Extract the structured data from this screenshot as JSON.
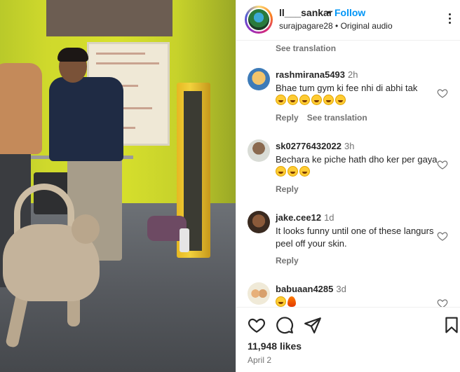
{
  "header": {
    "username": "ll___sankar",
    "separator": "•",
    "follow_label": "Follow",
    "subline": "surajpagare28 • Original audio"
  },
  "comments": {
    "top_see_translation": "See translation",
    "reply_label": "Reply",
    "see_translation_label": "See translation",
    "items": [
      {
        "username": "rashmirana5493",
        "time": "2h",
        "text": "Bhae tum gym ki fee nhi di abhi tak",
        "emojis": "😂😂😂😂😂😂",
        "has_translation": true
      },
      {
        "username": "sk02776432022",
        "time": "3h",
        "text": "Bechara ke piche hath dho ker per gaya",
        "emojis": "😂😂😂",
        "has_translation": false
      },
      {
        "username": "jake.cee12",
        "time": "1d",
        "text": "It looks funny until one of these langurs peel off your skin.",
        "emojis": "",
        "has_translation": false
      },
      {
        "username": "babuaan4285",
        "time": "3d",
        "text": "",
        "emojis": "😂🔥",
        "has_translation": false
      }
    ]
  },
  "footer": {
    "likes": "11,948 likes",
    "date": "April 2"
  },
  "icons": {
    "like": "heart-icon",
    "comment": "comment-icon",
    "share": "share-icon",
    "save": "bookmark-icon",
    "more": "more-options-icon"
  },
  "colors": {
    "accent": "#0095f6",
    "text": "#262626",
    "secondary": "#737373"
  }
}
